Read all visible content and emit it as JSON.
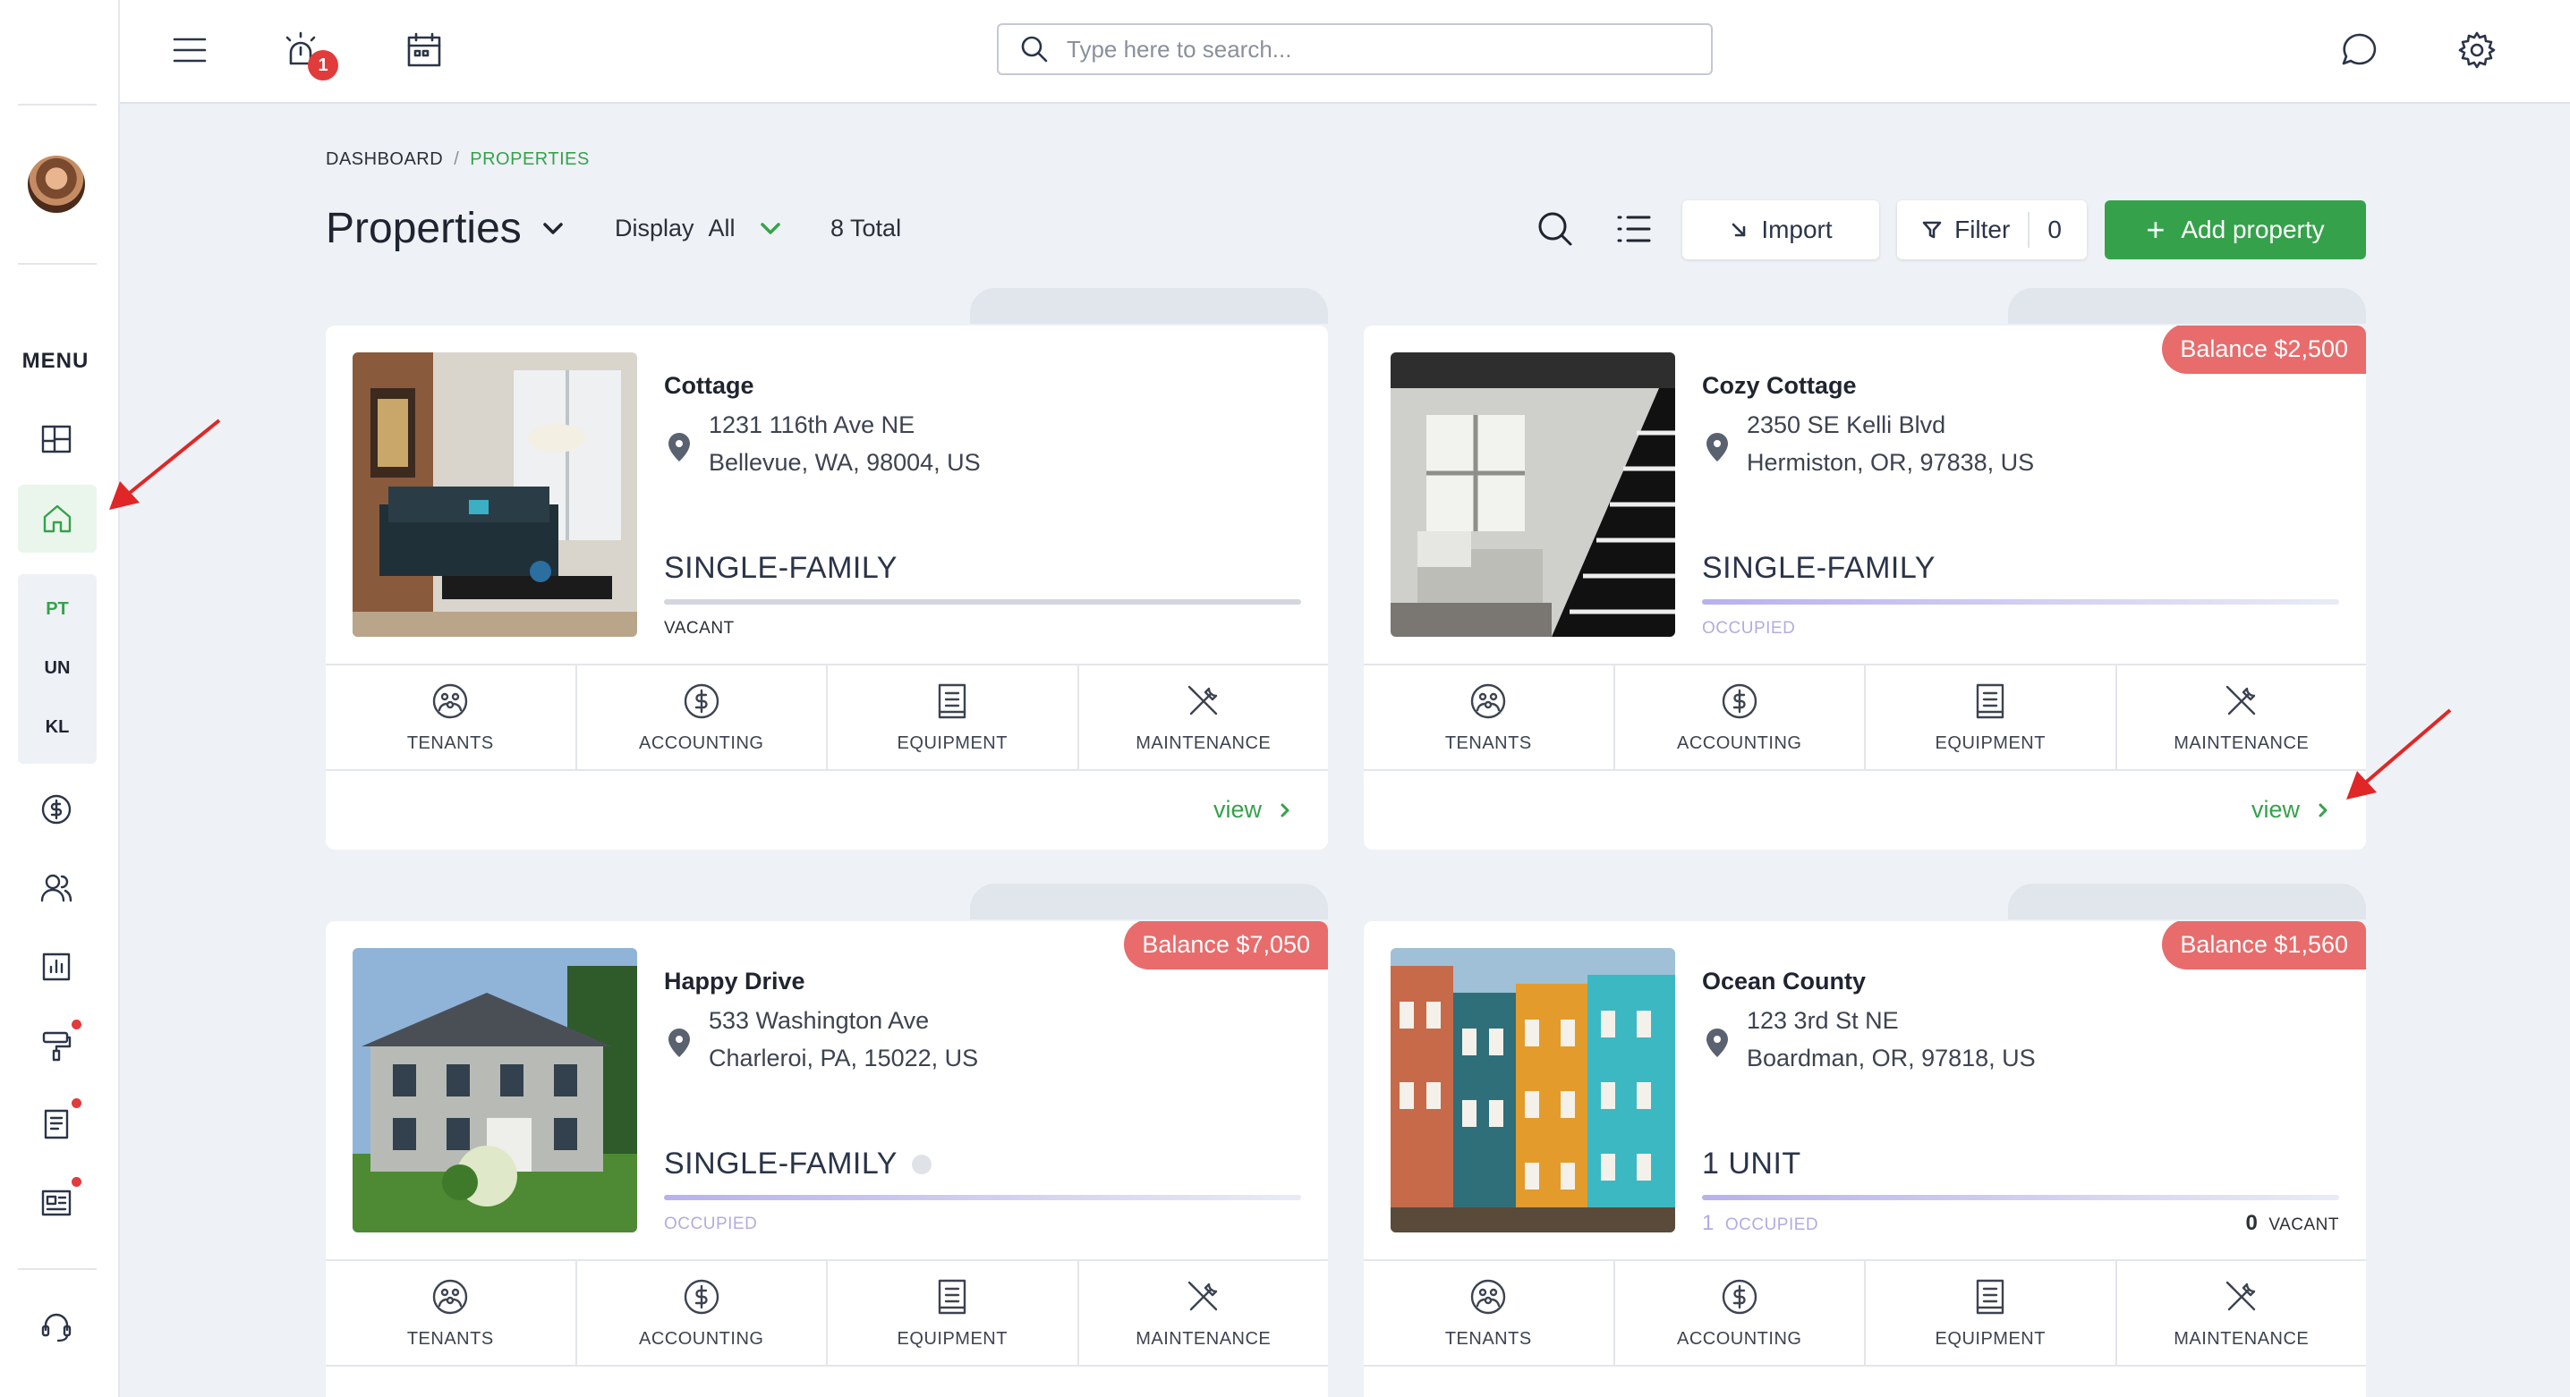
{
  "topbar": {
    "notification_count": "1",
    "search_placeholder": "Type here to search..."
  },
  "sidebar": {
    "menu_label": "MENU",
    "abbreviations": [
      {
        "label": "PT",
        "color": "#35a24b"
      },
      {
        "label": "UN",
        "color": "#1f2430"
      },
      {
        "label": "KL",
        "color": "#1f2430"
      }
    ]
  },
  "breadcrumb": {
    "root": "DASHBOARD",
    "separator": "/",
    "current": "PROPERTIES"
  },
  "header": {
    "title": "Properties",
    "display_label": "Display",
    "display_value": "All",
    "total": "8 Total",
    "import_label": "Import",
    "filter_label": "Filter",
    "filter_count": "0",
    "add_label": "Add property"
  },
  "actions": {
    "tenants": "TENANTS",
    "accounting": "ACCOUNTING",
    "equipment": "EQUIPMENT",
    "maintenance": "MAINTENANCE"
  },
  "view_label": "view",
  "properties": [
    {
      "name": "Cottage",
      "address1": "1231 116th Ave NE",
      "address2": "Bellevue, WA, 98004, US",
      "type": "SINGLE-FAMILY",
      "status": "VACANT",
      "balance": ""
    },
    {
      "name": "Cozy Cottage",
      "address1": "2350 SE Kelli Blvd",
      "address2": "Hermiston, OR, 97838, US",
      "type": "SINGLE-FAMILY",
      "status": "OCCUPIED",
      "balance": "Balance $2,500"
    },
    {
      "name": "Happy Drive",
      "address1": "533 Washington Ave",
      "address2": "Charleroi, PA, 15022, US",
      "type": "SINGLE-FAMILY",
      "status": "OCCUPIED",
      "balance": "Balance $7,050"
    },
    {
      "name": "Ocean County",
      "address1": "123 3rd St NE",
      "address2": "Boardman, OR, 97818, US",
      "type": "1 UNIT",
      "occupied_count": "1",
      "occupied_label": "OCCUPIED",
      "vacant_count": "0",
      "vacant_label": "VACANT",
      "balance": "Balance $1,560"
    }
  ],
  "colors": {
    "accent_green": "#35a24b",
    "balance_red": "#e86c6c",
    "occupied_purple": "#b2acdf",
    "annotation_arrow": "#e02626"
  }
}
